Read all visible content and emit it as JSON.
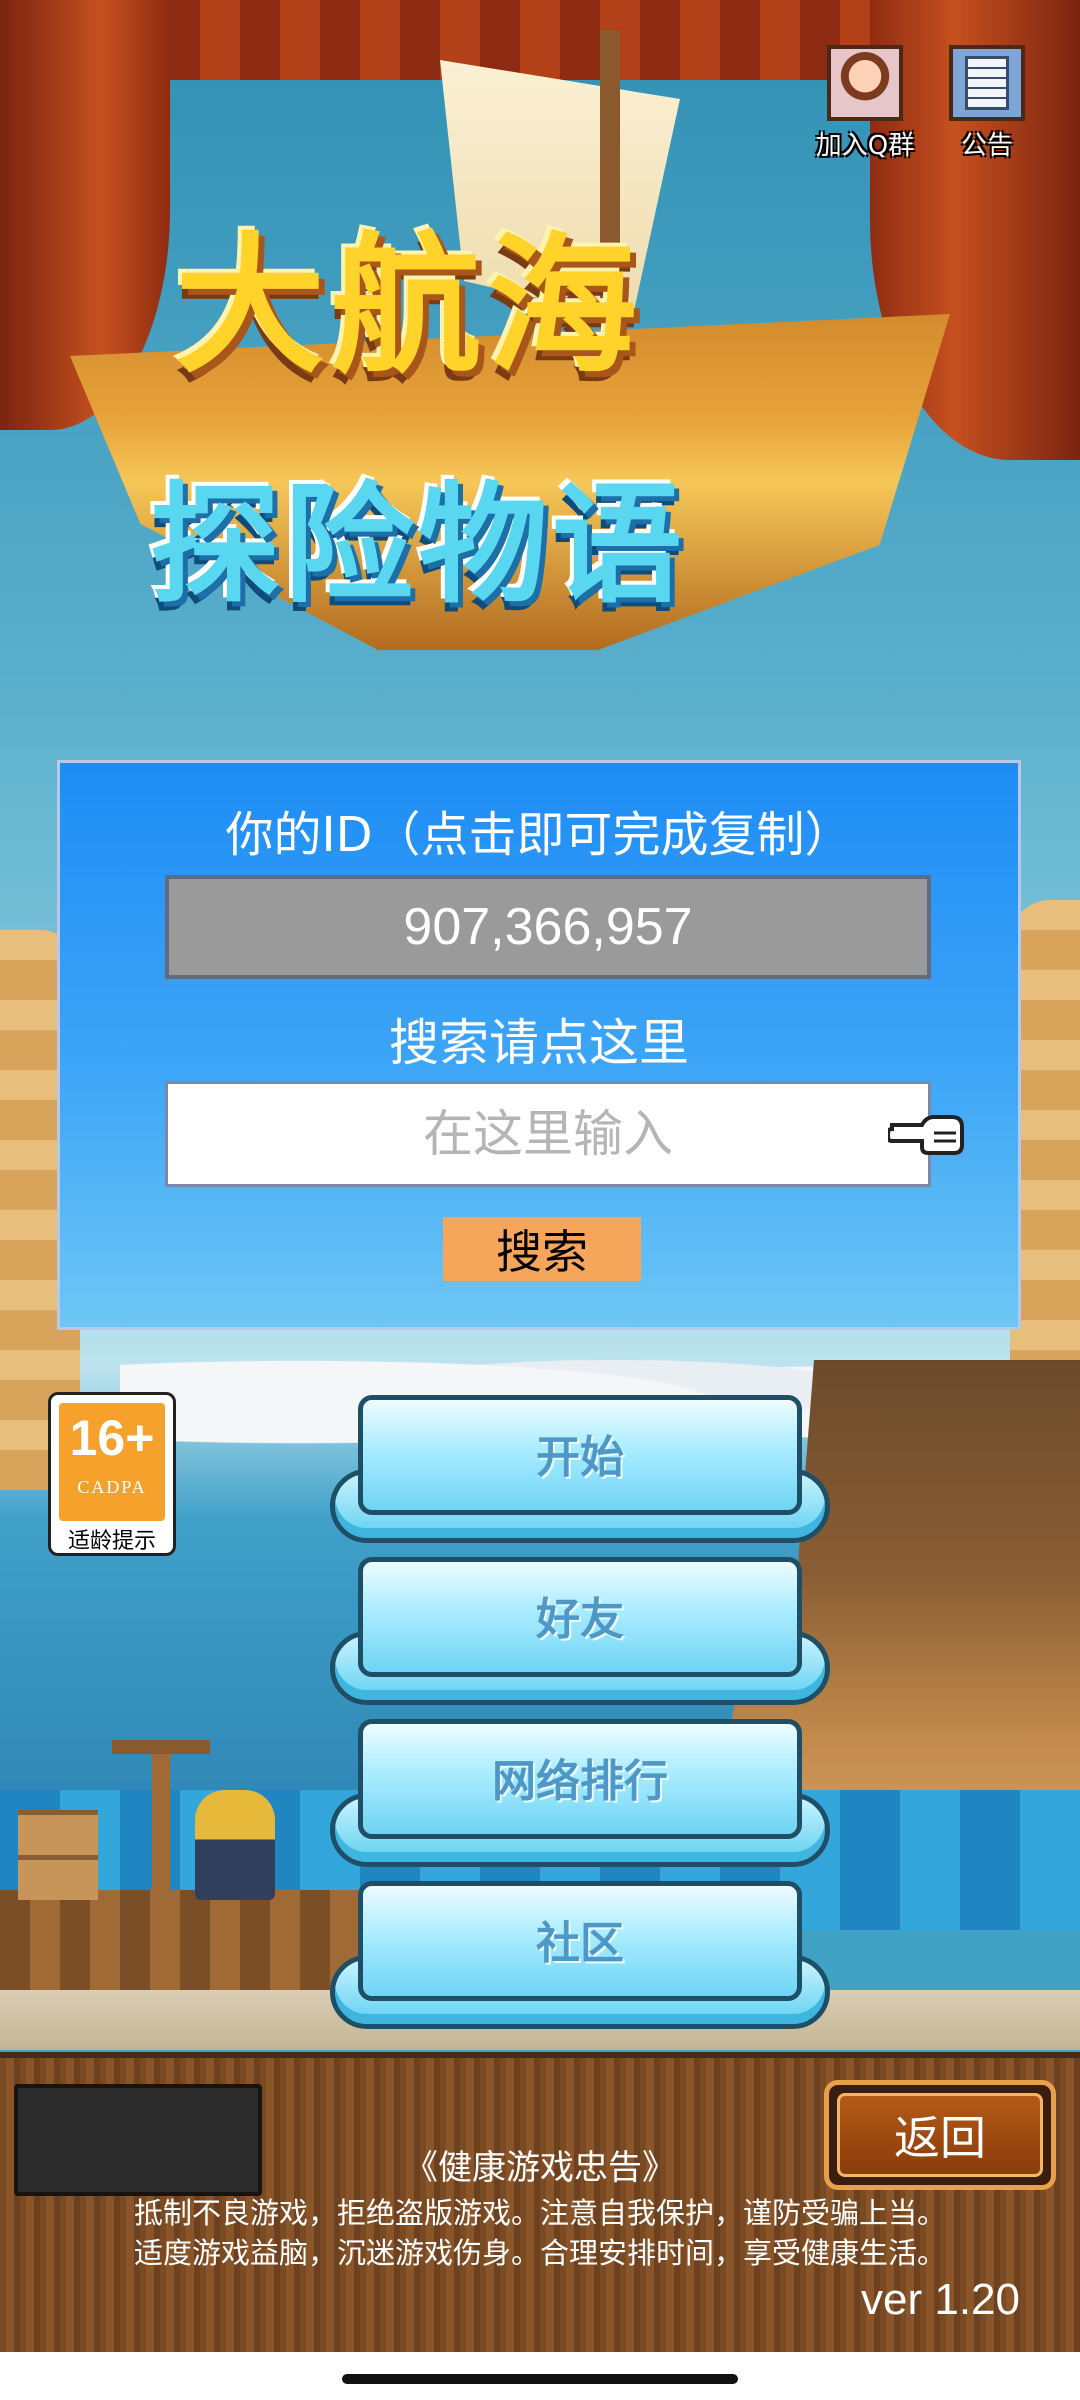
{
  "top_icons": {
    "qq_group_label": "加入Q群",
    "notice_label": "公告"
  },
  "logo": {
    "title": "大航海",
    "subtitle": "探险物语"
  },
  "id_panel": {
    "title": "你的ID（点击即可完成复制）",
    "id_value": "907,366,957",
    "search_hint": "搜索请点这里",
    "search_placeholder": "在这里输入",
    "search_button": "搜索"
  },
  "age_rating": {
    "rating": "16+",
    "org": "CADPA",
    "tip": "适龄提示"
  },
  "menu": {
    "items": [
      {
        "label": "开始"
      },
      {
        "label": "好友"
      },
      {
        "label": "网络排行"
      },
      {
        "label": "社区"
      }
    ]
  },
  "bottom": {
    "back_label": "返回",
    "health_title": "《健康游戏忠告》",
    "health_line1": "抵制不良游戏，拒绝盗版游戏。注意自我保护，谨防受骗上当。",
    "health_line2": "适度游戏益脑，沉迷游戏伤身。合理安排时间，享受健康生活。",
    "version": "ver 1.20"
  },
  "colors": {
    "panel_blue": "#1e8cf5",
    "search_button": "#f5a65a",
    "age_orange": "#f5a12b",
    "back_border": "#e9a04a"
  }
}
